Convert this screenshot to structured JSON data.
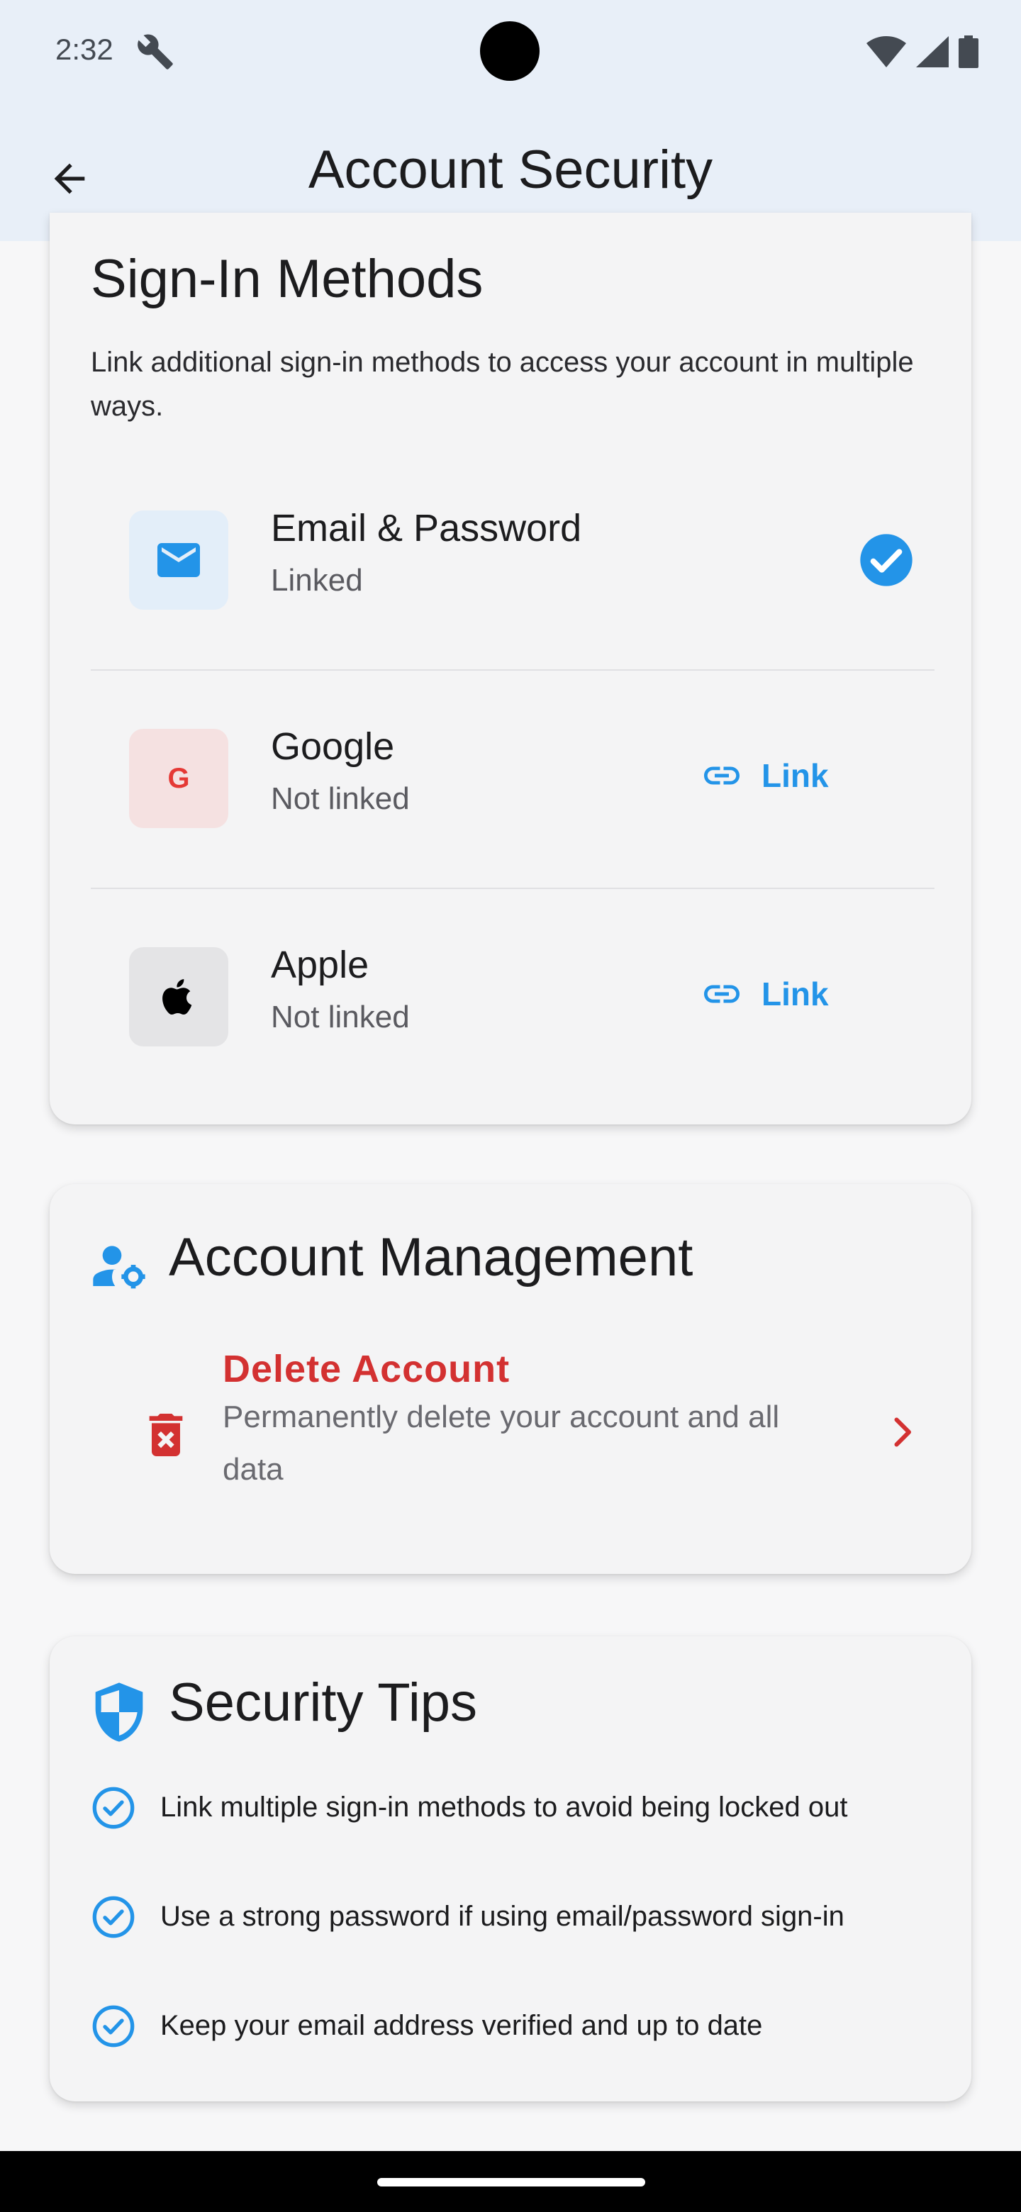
{
  "status_bar": {
    "time": "2:32"
  },
  "app_bar": {
    "title": "Account Security"
  },
  "sign_in": {
    "title": "Sign-In Methods",
    "description": "Link additional sign-in methods to access your account in multiple ways.",
    "methods": [
      {
        "name": "Email & Password",
        "status": "Linked",
        "icon": "mail-icon",
        "linked": true
      },
      {
        "name": "Google",
        "status": "Not linked",
        "icon": "google-icon",
        "icon_letter": "G",
        "action_label": "Link",
        "linked": false
      },
      {
        "name": "Apple",
        "status": "Not linked",
        "icon": "apple-icon",
        "action_label": "Link",
        "linked": false
      }
    ]
  },
  "account_management": {
    "title": "Account Management",
    "delete": {
      "title": "Delete Account",
      "description": "Permanently delete your account and all data"
    }
  },
  "security_tips": {
    "title": "Security Tips",
    "tips": [
      "Link multiple sign-in methods to avoid being locked out",
      "Use a strong password if using email/password sign-in",
      "Keep your email address verified and up to date"
    ]
  },
  "colors": {
    "accent": "#2394e8",
    "danger": "#d33131",
    "app_bar_bg": "#e8eff8",
    "card_bg": "#f4f4f5"
  }
}
